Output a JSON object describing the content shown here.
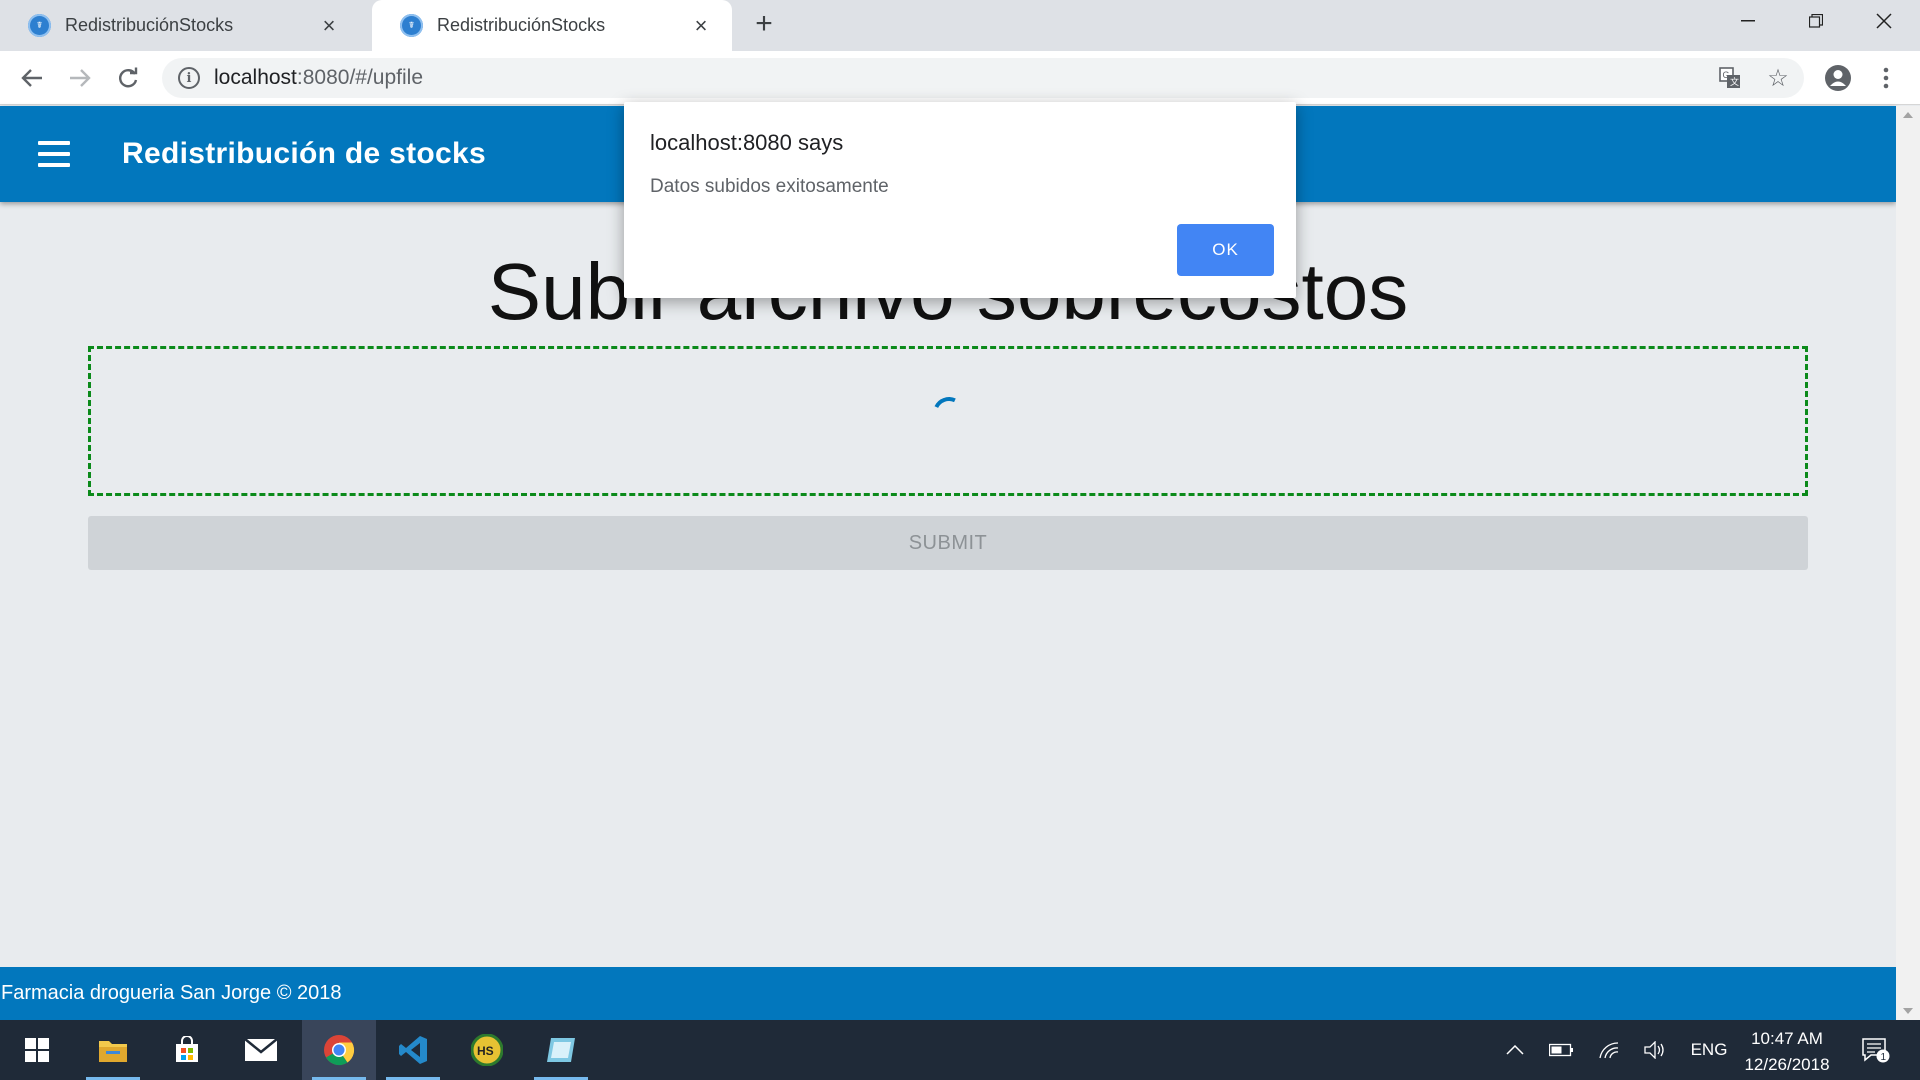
{
  "browser": {
    "tabs": [
      {
        "title": "RedistribuciónStocks",
        "active": false
      },
      {
        "title": "RedistribuciónStocks",
        "active": true
      }
    ],
    "new_tab_glyph": "+",
    "url_host": "localhost",
    "url_rest": ":8080/#/upfile",
    "icons": [
      "back-arrow-icon",
      "forward-arrow-icon",
      "reload-icon",
      "info-icon",
      "translate-icon",
      "star-icon",
      "account-icon",
      "menu-dots-icon",
      "minimize-icon",
      "restore-icon",
      "close-icon"
    ]
  },
  "app": {
    "title": "Redistribución de stocks",
    "page_title": "Subir archivo sobrecostos",
    "submit_label": "SUBMIT",
    "footer_text": "Farmacia drogueria San Jorge © 2018",
    "colors": {
      "app_bar": "#0277bd",
      "dropzone_border": "#0b8a1a",
      "submit_bg": "#cfd3d7"
    }
  },
  "dialog": {
    "title": "localhost:8080 says",
    "message": "Datos subidos exitosamente",
    "ok_label": "OK",
    "ok_color": "#4285f4"
  },
  "taskbar": {
    "apps": [
      "start-icon",
      "file-explorer-icon",
      "store-icon",
      "mail-icon",
      "chrome-icon",
      "vscode-icon",
      "hs-app-icon",
      "notes-app-icon"
    ],
    "tray": {
      "language": "ENG",
      "time": "10:47 AM",
      "date": "12/26/2018",
      "notification_count": "1"
    }
  }
}
